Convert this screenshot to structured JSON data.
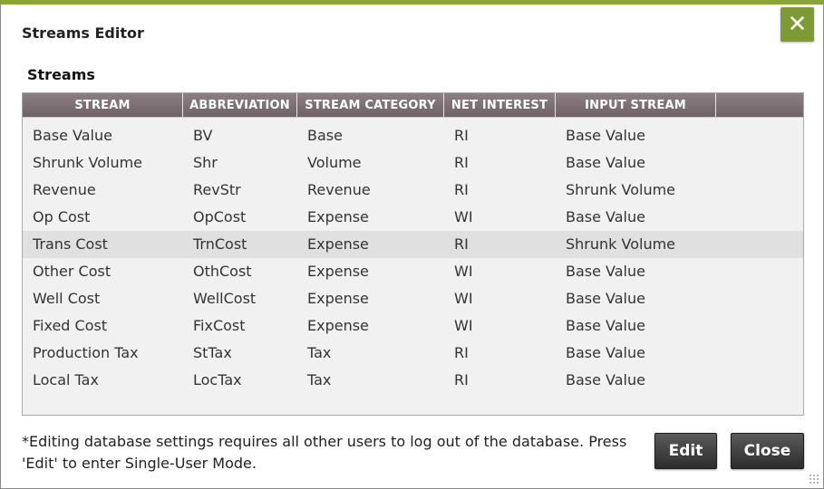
{
  "dialog": {
    "title": "Streams Editor",
    "close_glyph": "✕"
  },
  "streams": {
    "section_title": "Streams",
    "columns": [
      "STREAM",
      "ABBREVIATION",
      "STREAM CATEGORY",
      "NET INTEREST",
      "INPUT STREAM"
    ],
    "selected_row": 4,
    "rows": [
      [
        "Base Value",
        "BV",
        "Base",
        "RI",
        "Base Value"
      ],
      [
        "Shrunk Volume",
        "Shr",
        "Volume",
        "RI",
        "Base Value"
      ],
      [
        "Revenue",
        "RevStr",
        "Revenue",
        "RI",
        "Shrunk Volume"
      ],
      [
        "Op Cost",
        "OpCost",
        "Expense",
        "WI",
        "Base Value"
      ],
      [
        "Trans Cost",
        "TrnCost",
        "Expense",
        "RI",
        "Shrunk Volume"
      ],
      [
        "Other Cost",
        "OthCost",
        "Expense",
        "WI",
        "Base Value"
      ],
      [
        "Well Cost",
        "WellCost",
        "Expense",
        "WI",
        "Base Value"
      ],
      [
        "Fixed Cost",
        "FixCost",
        "Expense",
        "WI",
        "Base Value"
      ],
      [
        "Production Tax",
        "StTax",
        "Tax",
        "RI",
        "Base Value"
      ],
      [
        "Local Tax",
        "LocTax",
        "Tax",
        "RI",
        "Base Value"
      ]
    ]
  },
  "footer": {
    "note_line1": "*Editing database settings requires all other users to log out of the database. Press",
    "note_line2": "'Edit' to enter Single-User Mode.",
    "edit_label": "Edit",
    "close_label": "Close"
  },
  "colors": {
    "accent": "#8aa43a",
    "header": "#7a6e73",
    "button": "#3a3a3a"
  },
  "icons": {
    "close": "close-icon",
    "resize": "resize-grip-icon"
  }
}
